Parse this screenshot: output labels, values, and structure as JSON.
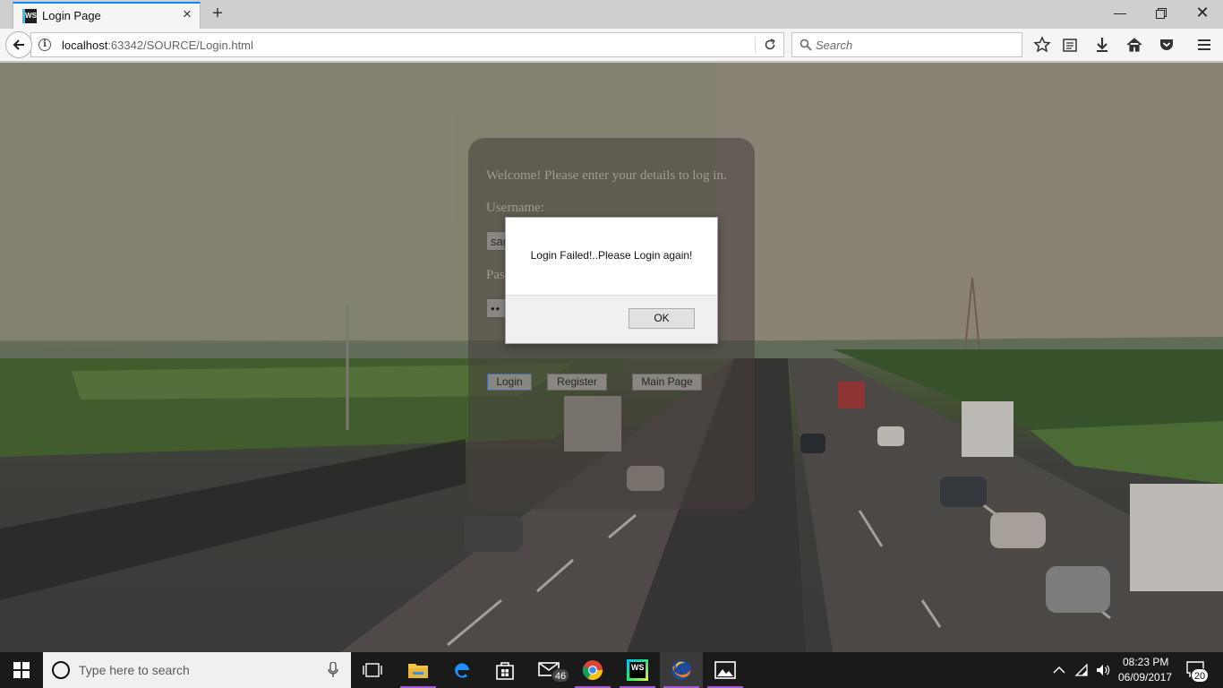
{
  "browser": {
    "tab": {
      "title": "Login Page",
      "favicon": "WS"
    },
    "url": {
      "host": "localhost",
      "rest": ":63342/SOURCE/Login.html"
    },
    "search_placeholder": "Search"
  },
  "login_panel": {
    "welcome": "Welcome! Please enter your details to log in.",
    "username_label": "Username:",
    "username_value": "sag",
    "password_label": "Pas",
    "password_value": "••",
    "buttons": {
      "login": "Login",
      "register": "Register",
      "main_page": "Main Page"
    }
  },
  "dialog": {
    "message": "Login Failed!..Please Login again!",
    "ok_label": "OK"
  },
  "taskbar": {
    "search_placeholder": "Type here to search",
    "mail_badge": "46",
    "notification_badge": "20",
    "time": "08:23 PM",
    "date": "06/09/2017"
  },
  "icons": [
    "back-arrow-icon",
    "info-icon",
    "reload-icon",
    "search-icon",
    "bookmark-star-icon",
    "reading-list-icon",
    "download-icon",
    "home-icon",
    "pocket-icon",
    "menu-icon",
    "windows-start-icon",
    "cortana-icon",
    "microphone-icon",
    "task-view-icon",
    "file-explorer-icon",
    "edge-icon",
    "store-icon",
    "mail-icon",
    "chrome-icon",
    "webstorm-icon",
    "firefox-icon",
    "photos-icon",
    "chevron-up-icon",
    "network-icon",
    "volume-icon",
    "action-center-icon"
  ],
  "colors": {
    "accent_blue": "#0a84ff",
    "taskbar": "#1a1a1a",
    "panel": "#463e3a"
  }
}
